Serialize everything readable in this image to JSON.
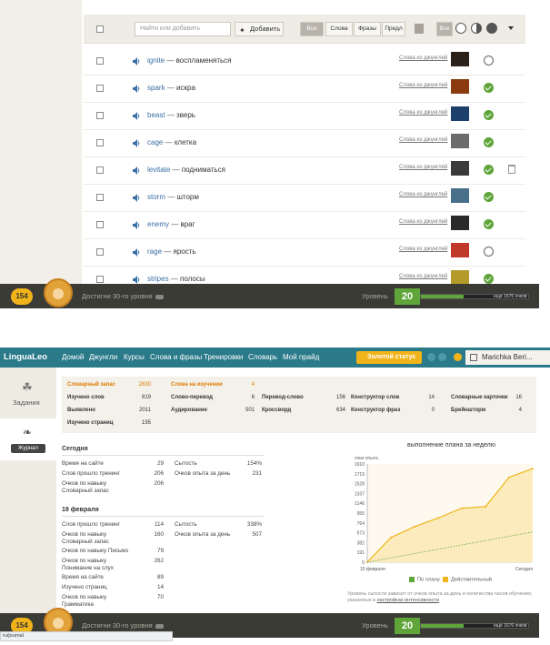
{
  "vocab": {
    "search_placeholder": "Найти или добавить",
    "add_label": "Добавить",
    "filters": [
      "Все",
      "Слова",
      "Фразы",
      "Предл"
    ],
    "status_filter_all": "Все",
    "words": [
      {
        "word": "ignite",
        "translation": "воспламеняться",
        "source": "Слова из джунглей",
        "status": "todo"
      },
      {
        "word": "spark",
        "translation": "искра",
        "source": "Слова из джунглей",
        "status": "done"
      },
      {
        "word": "beast",
        "translation": "зверь",
        "source": "Слова из джунглей",
        "status": "done"
      },
      {
        "word": "cage",
        "translation": "клетка",
        "source": "Слова из джунглей",
        "status": "done"
      },
      {
        "word": "levitate",
        "translation": "подниматься",
        "source": "Слова из джунглей",
        "status": "done"
      },
      {
        "word": "storm",
        "translation": "шторм",
        "source": "Слова из джунглей",
        "status": "done"
      },
      {
        "word": "enemy",
        "translation": "враг",
        "source": "Слова из джунглей",
        "status": "done"
      },
      {
        "word": "rage",
        "translation": "ярость",
        "source": "Слова из джунглей",
        "status": "todo"
      },
      {
        "word": "stripes",
        "translation": "полосы",
        "source": "Слова из джунглей",
        "status": "done"
      }
    ],
    "dash": "—"
  },
  "footer": {
    "coins": "154",
    "goal_text": "Достигни 30-го уровня",
    "level_label": "Уровень",
    "level": "20",
    "level_progress": 0.4,
    "points_left": "ещё 1676 очков"
  },
  "nav": {
    "logo": "LinguaLeo",
    "items": [
      "Домой",
      "Джунгли",
      "Курсы",
      "Слова и фразы",
      "Тренировки",
      "Словарь",
      "Мой прайд"
    ],
    "gold_status": "Золотой статус",
    "user": "Marichka Beri..."
  },
  "sidebar": {
    "tasks": "Задания",
    "journal": "Журнал"
  },
  "stats": {
    "vocab_label": "Словарный запас",
    "vocab_value": "2830",
    "learning_label": "Слова на изучении",
    "learning_value": "4",
    "row1": [
      {
        "label": "Изучено слов",
        "value": "819"
      },
      {
        "label": "Слово-перевод",
        "value": "6"
      },
      {
        "label": "Перевод-слово",
        "value": "156"
      },
      {
        "label": "Конструктор слов",
        "value": "14"
      },
      {
        "label": "Словарные карточки",
        "value": "16"
      }
    ],
    "row2": [
      {
        "label": "Выявлено",
        "value": "2011"
      },
      {
        "label": "Аудирование",
        "value": "501"
      },
      {
        "label": "Кроссворд",
        "value": "634"
      },
      {
        "label": "Конструктор фраз",
        "value": "0"
      },
      {
        "label": "Брейншторм",
        "value": "4"
      }
    ],
    "row3": [
      {
        "label": "Изучено страниц",
        "value": "195"
      }
    ]
  },
  "today": {
    "heading": "Сегодня",
    "left": [
      {
        "label": "Время на сайте",
        "value": "29"
      },
      {
        "label": "Слов прошло тренинг",
        "value": "206"
      },
      {
        "label": "Очков по навыку Словарный запас",
        "value": "206"
      }
    ],
    "right": [
      {
        "label": "Сытость",
        "value": "154%"
      },
      {
        "label": "Очков опыта за день",
        "value": "231"
      }
    ]
  },
  "feb19": {
    "heading": "19 февраля",
    "left": [
      {
        "label": "Слов прошло тренинг",
        "value": "114"
      },
      {
        "label": "Очков по навыку Словарный запас",
        "value": "160"
      },
      {
        "label": "Очков по навыку Письмо",
        "value": "79"
      },
      {
        "label": "Очков по навыку Понимание на слух",
        "value": "262"
      },
      {
        "label": "Время на сайте",
        "value": "89"
      },
      {
        "label": "Изучено страниц",
        "value": "14"
      },
      {
        "label": "Очков по навыку Грамматика",
        "value": "70"
      }
    ],
    "right": [
      {
        "label": "Сытость",
        "value": "338%"
      },
      {
        "label": "Очков опыта за день",
        "value": "507"
      }
    ]
  },
  "chart_data": {
    "type": "area",
    "title": "выполнение плана за неделю",
    "ylabel": "очки опыта",
    "yticks": [
      0,
      191,
      382,
      573,
      764,
      955,
      1146,
      1337,
      1528,
      1719,
      1910
    ],
    "ylim": [
      0,
      1910
    ],
    "x": [
      "10 февраля",
      "",
      "",
      "",
      "",
      "",
      "",
      "Сегодня"
    ],
    "series": [
      {
        "name": "По плану",
        "values": [
          0,
          84,
          168,
          252,
          336,
          420,
          504,
          590
        ],
        "color": "#5fa53a"
      },
      {
        "name": "Действительный",
        "values": [
          0,
          480,
          690,
          860,
          1050,
          1080,
          1650,
          1820
        ],
        "color": "#f0b31a"
      }
    ]
  },
  "note": {
    "text": "Уровень сытости зависит от очков опыта за день и количества часов обучения, указанных в",
    "link": "настройках интенсивности"
  },
  "status_url": "ru/journal"
}
